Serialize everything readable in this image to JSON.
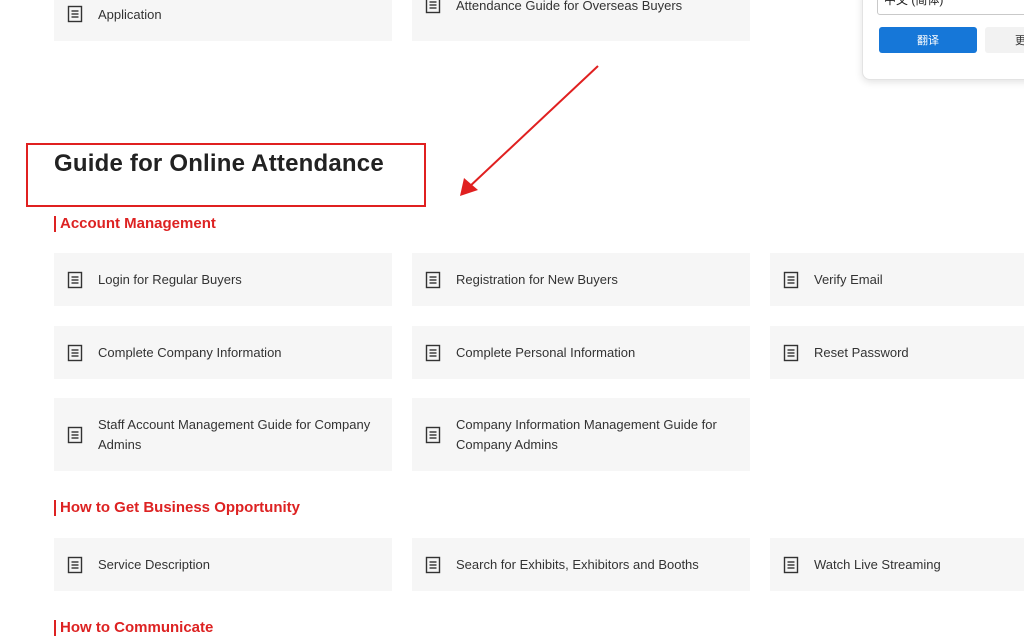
{
  "top_cards": [
    {
      "label": "Application",
      "icon": "document-icon"
    },
    {
      "label": "Attendance Guide for Overseas Buyers",
      "icon": "document-icon"
    }
  ],
  "translate_popup": {
    "language": "中文 (简体)",
    "translate_button": "翻译",
    "second_button": "更"
  },
  "page_title": "Guide for Online Attendance",
  "sections": [
    {
      "title": "Account Management",
      "items": [
        "Login for Regular Buyers",
        "Registration for New Buyers",
        "Verify Email",
        "Complete Company Information",
        "Complete Personal Information",
        "Reset Password",
        "Staff Account Management Guide for Company Admins",
        "Company Information Management Guide for Company Admins"
      ]
    },
    {
      "title": "How to Get Business Opportunity",
      "items": [
        "Service Description",
        "Search for Exhibits, Exhibitors and Booths",
        "Watch Live Streaming"
      ]
    },
    {
      "title": "How to Communicate",
      "items": []
    }
  ],
  "colors": {
    "accent_red": "#dd2222",
    "card_bg": "#f6f6f6",
    "button_blue": "#1677d8"
  }
}
